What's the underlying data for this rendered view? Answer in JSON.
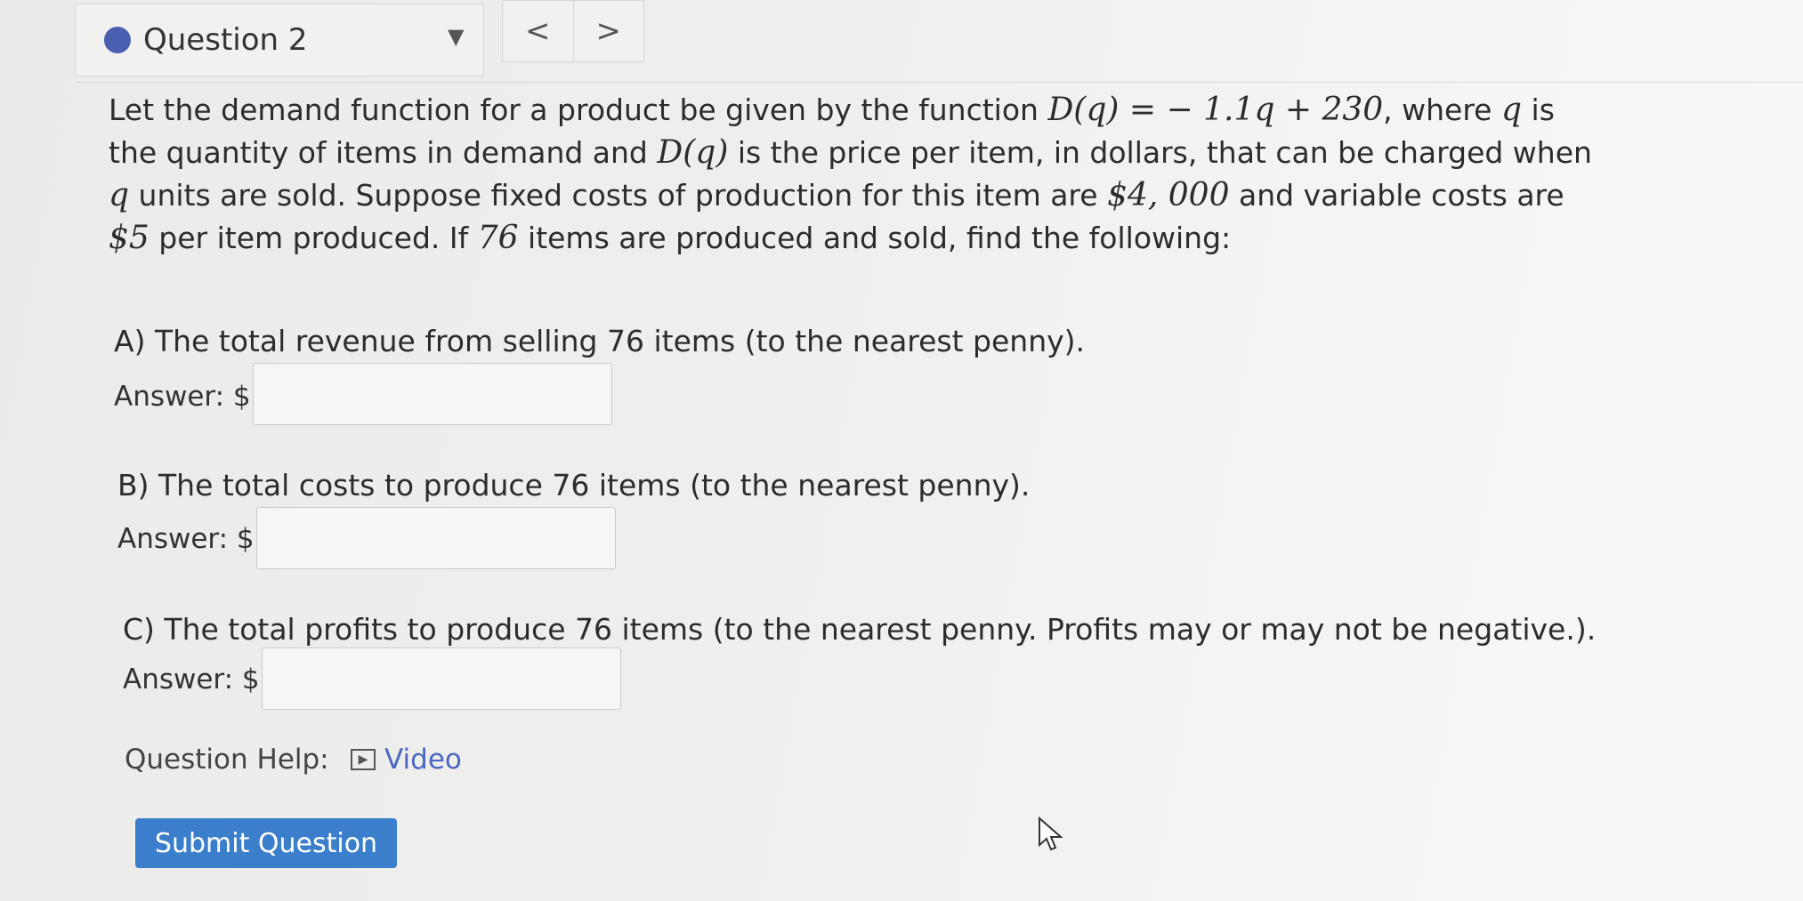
{
  "nav": {
    "question_label": "Question 2",
    "caret": "▼",
    "prev": "<",
    "next": ">",
    "dot_color": "#4b5fb0"
  },
  "problem": {
    "seg1": "Let the demand function for a product be given by the function ",
    "math1": "D(q) = − 1.1q + 230",
    "seg2": ", where ",
    "math2": "q",
    "seg3": " is the quantity of items in demand and ",
    "math3": "D(q)",
    "seg4": " is the price per item, in dollars, that can be charged when ",
    "math4": "q",
    "seg5": " units are sold. Suppose fixed costs of production for this item are ",
    "math5": "$4, 000",
    "seg6": " and variable costs are ",
    "math6": "$5",
    "seg7": " per item produced. If ",
    "math7": "76",
    "seg8": " items are produced and sold, find the following:"
  },
  "parts": [
    {
      "text": "A) The total revenue from selling 76 items (to the nearest penny).",
      "answer_label": "Answer: $",
      "value": ""
    },
    {
      "text": "B) The total costs to produce 76 items (to the nearest penny).",
      "answer_label": "Answer: $",
      "value": ""
    },
    {
      "text": "C) The total profits to produce 76 items (to the nearest penny. Profits may or may not be negative.).",
      "answer_label": "Answer: $",
      "value": ""
    }
  ],
  "help": {
    "label": "Question Help:",
    "video_icon": "play-icon",
    "video_label": "Video"
  },
  "submit_label": "Submit Question",
  "colors": {
    "accent": "#3b7ecb",
    "link": "#4b67c0"
  }
}
